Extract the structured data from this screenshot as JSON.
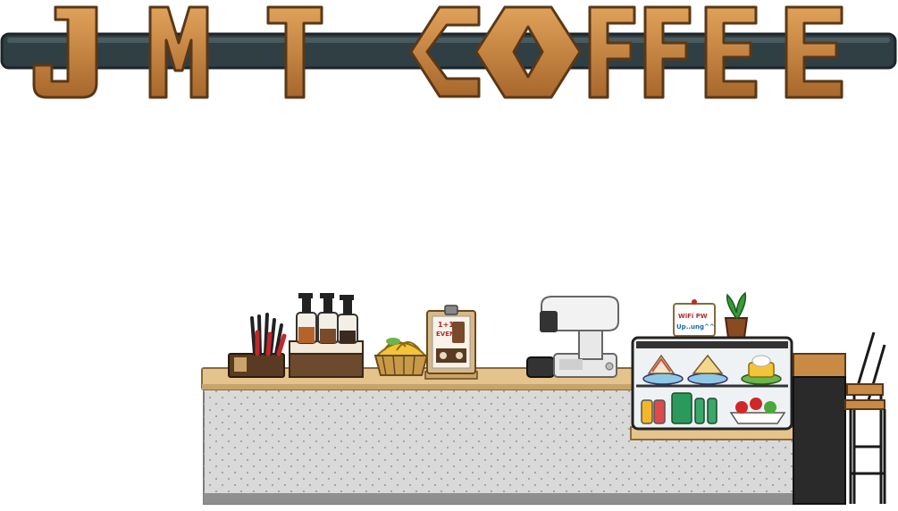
{
  "sign": {
    "words": [
      "J",
      "M",
      "T",
      "COFFEE"
    ],
    "colors": {
      "letter_fill": "#c98a45",
      "letter_stroke": "#5a3817",
      "bar": "#2f3f44",
      "bar_stroke": "#1c262a"
    }
  },
  "menu_board": {
    "line1": "1+1",
    "line2": "EVENT"
  },
  "wifi_note": {
    "line1": "WiFi PW",
    "line2": "Up..ung^^"
  },
  "colors": {
    "counter_top": "#e4c48c",
    "counter_front": "#d9d9d9",
    "counter_dots": "#9aa0a3",
    "stool": "#c98a45",
    "register": "#e8e8e8"
  }
}
